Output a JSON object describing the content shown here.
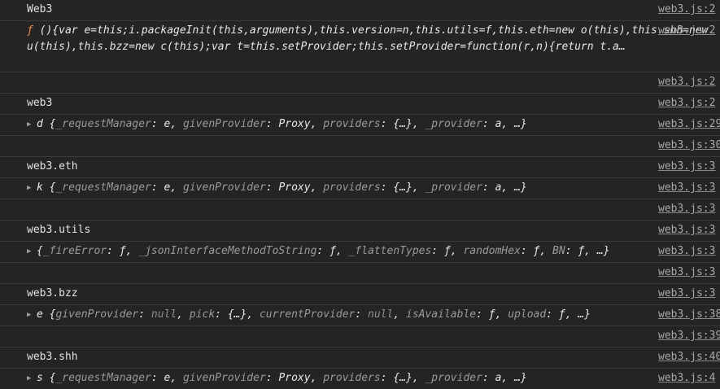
{
  "rows": [
    {
      "kind": "text",
      "text": "Web3",
      "source": "web3.js:2"
    },
    {
      "kind": "fn",
      "kw": "ƒ",
      "body": " (){var e=this;i.packageInit(this,arguments),this.version=n,this.utils=f,this.eth=new o(this),this.shh=new u(this),this.bzz=new c(this);var t=this.setProvider;this.setProvider=function(r,n){return t.a…",
      "source": "web3.js:2"
    },
    {
      "kind": "empty",
      "source": "web3.js:2"
    },
    {
      "kind": "text",
      "text": "web3",
      "source": "web3.js:2"
    },
    {
      "kind": "object",
      "prefix": "d",
      "props": [
        {
          "k": "_requestManager",
          "v": "e"
        },
        {
          "k": "givenProvider",
          "v": "Proxy"
        },
        {
          "k": "providers",
          "v": "{…}"
        },
        {
          "k": "_provider",
          "v": "a"
        }
      ],
      "source": "web3.js:29"
    },
    {
      "kind": "empty",
      "source": "web3.js:30"
    },
    {
      "kind": "text",
      "text": "web3.eth",
      "source": "web3.js:3"
    },
    {
      "kind": "object",
      "prefix": "k",
      "props": [
        {
          "k": "_requestManager",
          "v": "e"
        },
        {
          "k": "givenProvider",
          "v": "Proxy"
        },
        {
          "k": "providers",
          "v": "{…}"
        },
        {
          "k": "_provider",
          "v": "a"
        }
      ],
      "source": "web3.js:3"
    },
    {
      "kind": "empty",
      "source": "web3.js:3"
    },
    {
      "kind": "text",
      "text": "web3.utils",
      "source": "web3.js:3"
    },
    {
      "kind": "object",
      "prefix": "",
      "props": [
        {
          "k": "_fireError",
          "v": "ƒ"
        },
        {
          "k": "_jsonInterfaceMethodToString",
          "v": "ƒ"
        },
        {
          "k": "_flattenTypes",
          "v": "ƒ"
        },
        {
          "k": "randomHex",
          "v": "ƒ"
        },
        {
          "k": "BN",
          "v": "ƒ"
        }
      ],
      "source": "web3.js:3"
    },
    {
      "kind": "empty",
      "source": "web3.js:3"
    },
    {
      "kind": "text",
      "text": "web3.bzz",
      "source": "web3.js:3"
    },
    {
      "kind": "object",
      "prefix": "e",
      "props": [
        {
          "k": "givenProvider",
          "v": "null",
          "null": true
        },
        {
          "k": "pick",
          "v": "{…}"
        },
        {
          "k": "currentProvider",
          "v": "null",
          "null": true
        },
        {
          "k": "isAvailable",
          "v": "ƒ"
        },
        {
          "k": "upload",
          "v": "ƒ"
        }
      ],
      "source": "web3.js:38"
    },
    {
      "kind": "empty",
      "source": "web3.js:39"
    },
    {
      "kind": "text",
      "text": "web3.shh",
      "source": "web3.js:40"
    },
    {
      "kind": "object",
      "prefix": "s",
      "props": [
        {
          "k": "_requestManager",
          "v": "e"
        },
        {
          "k": "givenProvider",
          "v": "Proxy"
        },
        {
          "k": "providers",
          "v": "{…}"
        },
        {
          "k": "_provider",
          "v": "a"
        }
      ],
      "source": "web3.js:4"
    }
  ]
}
